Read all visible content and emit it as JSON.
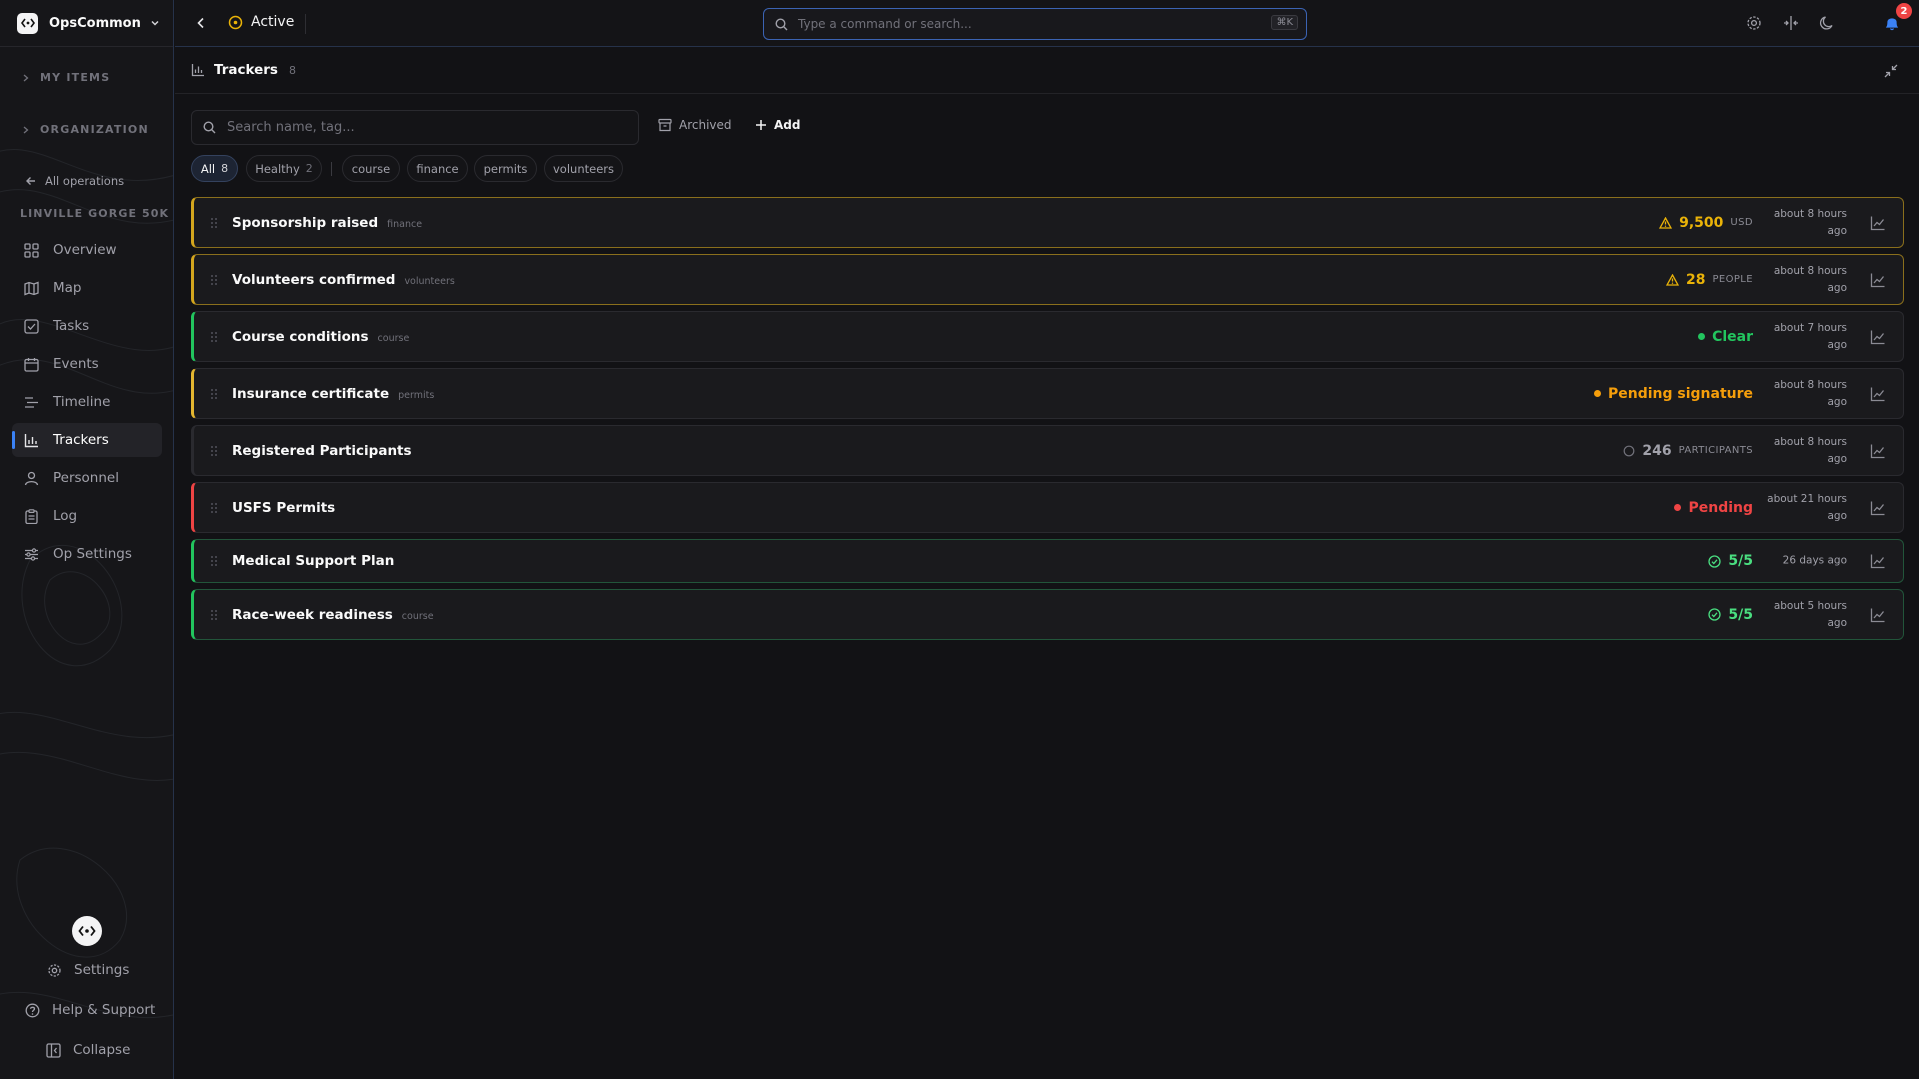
{
  "app": {
    "name": "OpsCommon"
  },
  "sidebar": {
    "sections": [
      {
        "label": "MY ITEMS"
      },
      {
        "label": "ORGANIZATION"
      }
    ],
    "back_label": "All operations",
    "operation_title": "LINVILLE GORGE 50K",
    "nav": [
      {
        "label": "Overview",
        "icon": "grid-icon"
      },
      {
        "label": "Map",
        "icon": "map-icon"
      },
      {
        "label": "Tasks",
        "icon": "check-square-icon"
      },
      {
        "label": "Events",
        "icon": "calendar-icon"
      },
      {
        "label": "Timeline",
        "icon": "list-icon"
      },
      {
        "label": "Trackers",
        "icon": "bar-chart-icon",
        "active": true
      },
      {
        "label": "Personnel",
        "icon": "user-icon"
      },
      {
        "label": "Log",
        "icon": "clipboard-icon"
      },
      {
        "label": "Op Settings",
        "icon": "sliders-icon"
      }
    ],
    "bottom": {
      "settings": "Settings",
      "help": "Help & Support",
      "collapse": "Collapse"
    }
  },
  "topbar": {
    "status": "Active",
    "search_placeholder": "Type a command or search...",
    "shortcut": "⌘K",
    "notification_count": "2"
  },
  "panel": {
    "title": "Trackers",
    "count": "8",
    "search_placeholder": "Search name, tag...",
    "archived_label": "Archived",
    "add_label": "Add"
  },
  "filters": [
    {
      "label": "All",
      "count": "8",
      "selected": true
    },
    {
      "label": "Healthy",
      "count": "2"
    },
    {
      "label": "course"
    },
    {
      "label": "finance"
    },
    {
      "label": "permits"
    },
    {
      "label": "volunteers"
    }
  ],
  "trackers": [
    {
      "name": "Sponsorship raised",
      "tag": "finance",
      "value": "9,500",
      "unit": "USD",
      "status": "warning",
      "color": "#eab308",
      "time_line1": "about 8 hours",
      "time_line2": "ago"
    },
    {
      "name": "Volunteers confirmed",
      "tag": "volunteers",
      "value": "28",
      "unit": "PEOPLE",
      "status": "warning",
      "color": "#eab308",
      "time_line1": "about 8 hours",
      "time_line2": "ago"
    },
    {
      "name": "Course conditions",
      "tag": "course",
      "value": "Clear",
      "unit": "",
      "status": "ok",
      "color": "#22c55e",
      "time_line1": "about 7 hours",
      "time_line2": "ago"
    },
    {
      "name": "Insurance certificate",
      "tag": "permits",
      "value": "Pending signature",
      "unit": "",
      "status": "pending",
      "color": "#f59e0b",
      "time_line1": "about 8 hours",
      "time_line2": "ago"
    },
    {
      "name": "Registered Participants",
      "tag": "",
      "value": "246",
      "unit": "PARTICIPANTS",
      "status": "neutral",
      "color": "#a1a1aa",
      "time_line1": "about 8 hours",
      "time_line2": "ago"
    },
    {
      "name": "USFS Permits",
      "tag": "",
      "value": "Pending",
      "unit": "",
      "status": "critical",
      "color": "#ef4444",
      "time_line1": "about 21 hours",
      "time_line2": "ago"
    },
    {
      "name": "Medical Support Plan",
      "tag": "",
      "value": "5/5",
      "unit": "",
      "status": "complete",
      "color": "#4ade80",
      "time_line1": "26 days ago",
      "time_line2": ""
    },
    {
      "name": "Race-week readiness",
      "tag": "course",
      "value": "5/5",
      "unit": "",
      "status": "complete",
      "color": "#4ade80",
      "time_line1": "about 5 hours",
      "time_line2": "ago"
    }
  ],
  "colors": {
    "accent": "#3b82f6",
    "warning": "#eab308",
    "ok": "#22c55e",
    "critical": "#ef4444"
  }
}
